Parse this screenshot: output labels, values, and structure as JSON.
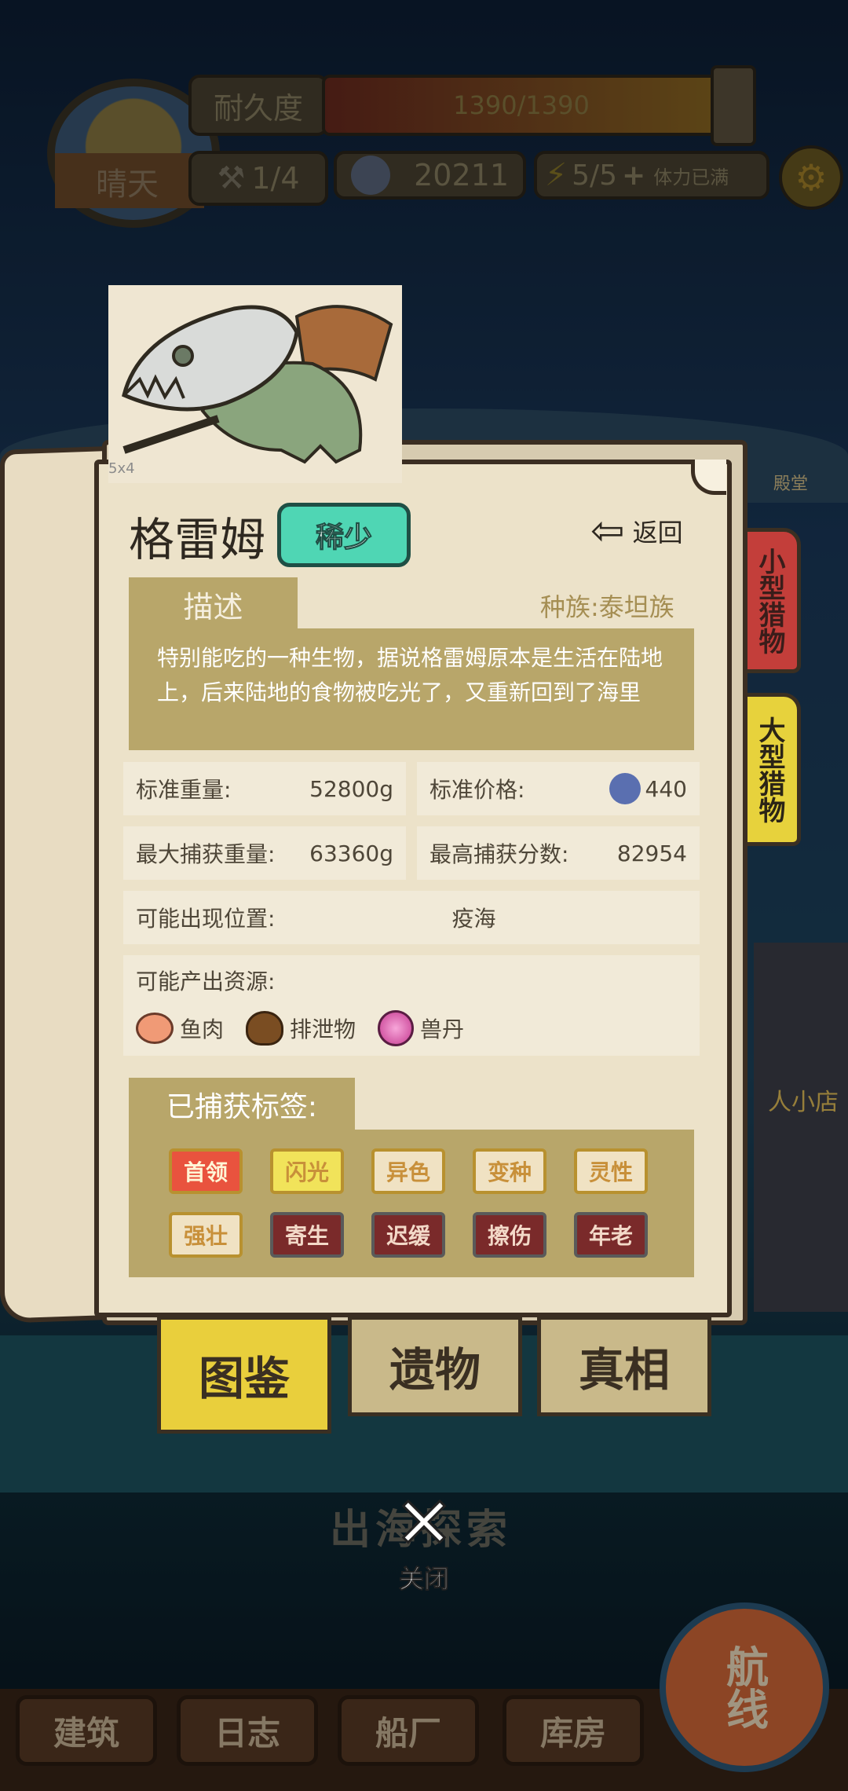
{
  "hud": {
    "durability_label": "耐久度",
    "durability_value": "1390/1390",
    "weather": "晴天",
    "tools": "1/4",
    "coins": "20211",
    "stamina": "5/5",
    "stamina_plus": "+",
    "stamina_status": "体力已满"
  },
  "creature": {
    "name": "格雷姆",
    "rarity": "稀少",
    "back_label": "返回",
    "image_caption": "5x4",
    "desc_heading": "描述",
    "race": "种族:泰坦族",
    "description": "特别能吃的一种生物，据说格雷姆原本是生活在陆地上，后来陆地的食物被吃光了，又重新回到了海里",
    "stats": {
      "std_weight_label": "标准重量:",
      "std_weight": "52800g",
      "std_price_label": "标准价格:",
      "std_price": "440",
      "max_weight_label": "最大捕获重量:",
      "max_weight": "63360g",
      "max_score_label": "最高捕获分数:",
      "max_score": "82954",
      "location_label": "可能出现位置:",
      "location": "疫海",
      "resources_label": "可能产出资源:"
    },
    "resources": [
      "鱼肉",
      "排泄物",
      "兽丹"
    ],
    "tags_heading": "已捕获标签:",
    "tags": [
      "首领",
      "闪光",
      "异色",
      "变种",
      "灵性",
      "强壮",
      "寄生",
      "迟缓",
      "擦伤",
      "年老"
    ],
    "tag_colors": [
      "#e9533e",
      "#f1e35a",
      "#f0e2c3",
      "#f0e2c3",
      "#f0e2c3",
      "#f0e2c3",
      "#7a2a2a",
      "#7a2a2a",
      "#7a2a2a",
      "#7a2a2a"
    ]
  },
  "side_tabs": [
    "小型猎物",
    "大型猎物"
  ],
  "side_tab_colors": [
    "#c33e3a",
    "#e7d23c"
  ],
  "bottom_tabs": [
    "图鉴",
    "遗物",
    "真相"
  ],
  "close_label": "关闭",
  "background": {
    "explore_button": "出海探索",
    "shop_sign": "人小店",
    "temple_sign": "殿堂",
    "nav_buttons": [
      "建筑",
      "日志",
      "船厂",
      "库房"
    ],
    "route_label": "航线"
  }
}
